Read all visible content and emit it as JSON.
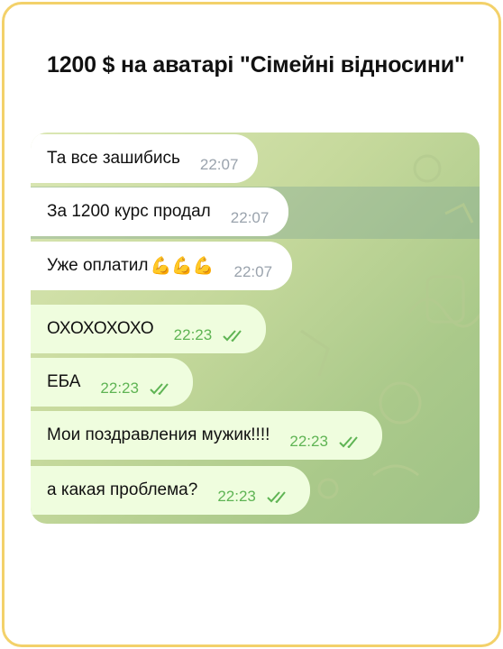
{
  "title": "1200 $ на аватарі \"Сімейні відносини\"",
  "messages": [
    {
      "text": "Та все зашибись",
      "time": "22:07",
      "direction": "in"
    },
    {
      "text": "За 1200 курс продал",
      "time": "22:07",
      "direction": "in"
    },
    {
      "text": "Уже оплатил",
      "emoji": "💪💪💪",
      "time": "22:07",
      "direction": "in"
    },
    {
      "text": "ОХОХОХОХО",
      "time": "22:23",
      "direction": "out",
      "status": "read"
    },
    {
      "text": "ЕБА",
      "time": "22:23",
      "direction": "out",
      "status": "read"
    },
    {
      "text": "Мои поздравления мужик!!!!",
      "time": "22:23",
      "direction": "out",
      "status": "read"
    },
    {
      "text": "а какая проблема?",
      "time": "22:23",
      "direction": "out",
      "status": "read"
    }
  ],
  "colors": {
    "border": "#f3d16a",
    "incoming_bubble": "#ffffff",
    "outgoing_bubble": "#effdde",
    "read_ticks": "#5fb454",
    "incoming_time": "#9aa3ad"
  }
}
